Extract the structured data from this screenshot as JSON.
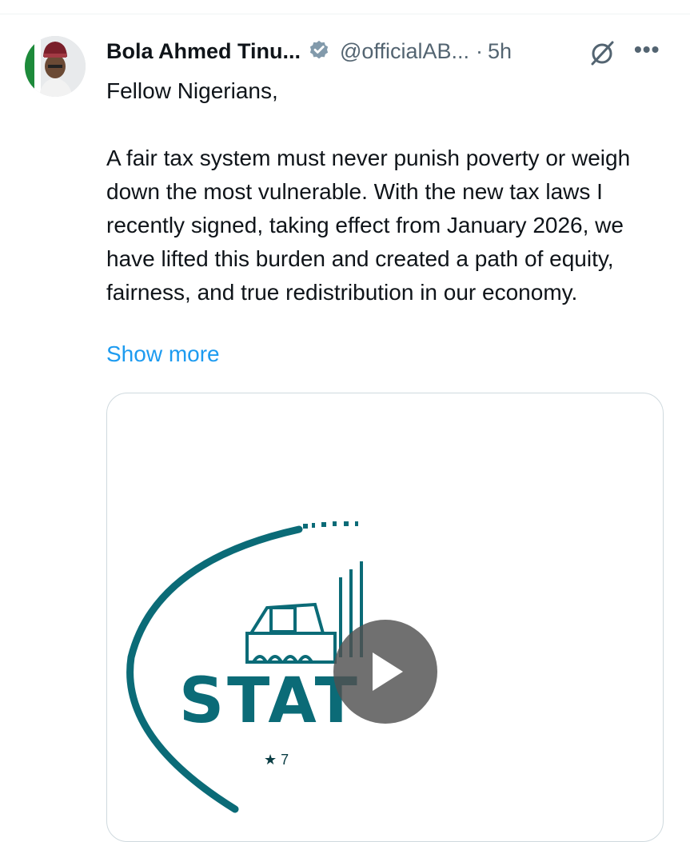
{
  "tweet": {
    "author_name": "Bola Ahmed Tinu...",
    "handle": "@officialAB...",
    "separator": "·",
    "time": "5h",
    "more": "•••",
    "text_lines": {
      "greeting": "Fellow Nigerians,",
      "body": "A fair tax system must never punish poverty or weigh down the most vulnerable. With the new tax laws I recently signed, taking effect from January 2026, we have lifted this burden and created a path of equity, fairness, and true redistribution in our economy."
    },
    "show_more": "Show more"
  },
  "media": {
    "partial_word": "STAT",
    "star_caption": "★ 7"
  },
  "colors": {
    "link": "#1d9bf0",
    "verified": "#829aab",
    "teal": "#0b6b77",
    "muted": "#536471"
  },
  "icons": {
    "verified": "verified-badge-icon",
    "grok": "grok-icon",
    "more": "more-icon",
    "play": "play-icon"
  }
}
